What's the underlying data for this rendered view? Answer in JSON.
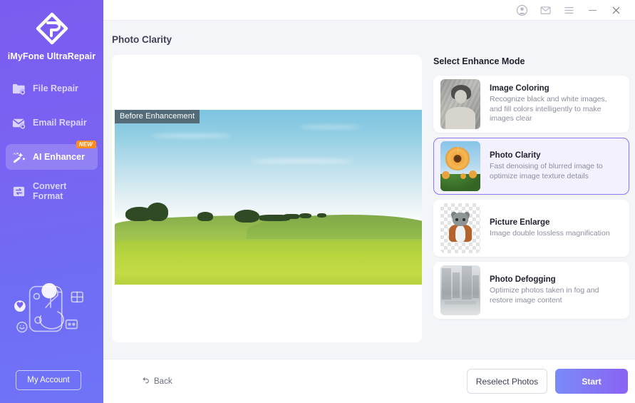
{
  "app": {
    "brand": "iMyFone UltraRepair",
    "logo_icon": "diamond-wrench-logo"
  },
  "titlebar": {
    "buttons": [
      {
        "name": "account-icon",
        "glyph": "person"
      },
      {
        "name": "mail-icon",
        "glyph": "envelope"
      },
      {
        "name": "menu-icon",
        "glyph": "hamburger"
      },
      {
        "name": "minimize-icon",
        "glyph": "minus"
      },
      {
        "name": "close-icon",
        "glyph": "cross"
      }
    ]
  },
  "sidebar": {
    "items": [
      {
        "label": "File Repair",
        "icon": "folder-repair-icon",
        "active": false,
        "badge": ""
      },
      {
        "label": "Email Repair",
        "icon": "envelope-repair-icon",
        "active": false,
        "badge": ""
      },
      {
        "label": "AI Enhancer",
        "icon": "magic-wand-icon",
        "active": true,
        "badge": "NEW"
      },
      {
        "label": "Convert Format",
        "icon": "convert-format-icon",
        "active": false,
        "badge": ""
      }
    ],
    "illustration_icon": "person-with-device-illustration",
    "account_button": "My Account"
  },
  "main": {
    "page_title": "Photo Clarity",
    "preview": {
      "before_label": "Before Enhancement",
      "image_icon": "green-field-landscape-photo"
    },
    "modes_title": "Select Enhance Mode",
    "modes": [
      {
        "name": "Image Coloring",
        "desc": "Recognize black and white images, and fill colors intelligently to make images clear",
        "thumb": "vintage-bw-portrait-thumbnail",
        "selected": false
      },
      {
        "name": "Photo Clarity",
        "desc": "Fast denoising of blurred image to optimize image texture details",
        "thumb": "sunflower-thumbnail",
        "selected": true
      },
      {
        "name": "Picture Enlarge",
        "desc": "Image double lossless magnification",
        "thumb": "cat-transparent-thumbnail",
        "selected": false
      },
      {
        "name": "Photo Defogging",
        "desc": "Optimize photos taken in fog and restore image content",
        "thumb": "foggy-city-thumbnail",
        "selected": false
      }
    ]
  },
  "footer": {
    "back_label": "Back",
    "back_icon": "undo-arrow-icon",
    "reselect_label": "Reselect Photos",
    "start_label": "Start"
  },
  "colors": {
    "sidebar_gradient_start": "#7b5cf0",
    "sidebar_gradient_end": "#6f74f6",
    "accent_purple": "#8b63f3",
    "badge_orange": "#ff8c1a",
    "selected_card_bg": "#f3f1fe",
    "selected_card_border": "#8b79f0",
    "page_bg": "#f4f5f9"
  }
}
